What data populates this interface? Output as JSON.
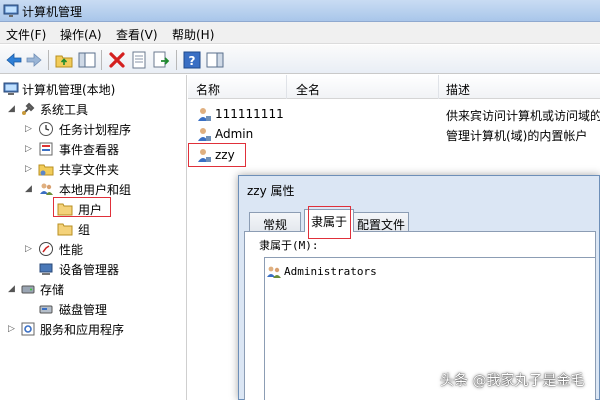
{
  "window": {
    "title": "计算机管理",
    "icon": "computer-management-icon"
  },
  "menu": {
    "items": [
      "文件(F)",
      "操作(A)",
      "查看(V)",
      "帮助(H)"
    ]
  },
  "toolbar": {
    "icons": [
      "back-arrow-icon",
      "forward-arrow-icon",
      "up-folder-icon",
      "show-hide-tree-icon",
      "delete-icon",
      "properties-icon",
      "export-list-icon",
      "help-icon",
      "action-pane-icon"
    ]
  },
  "tree": {
    "root": "计算机管理(本地)",
    "system_tools": "系统工具",
    "task_scheduler": "任务计划程序",
    "event_viewer": "事件查看器",
    "shared_folders": "共享文件夹",
    "local_users_groups": "本地用户和组",
    "users": "用户",
    "groups": "组",
    "performance": "性能",
    "device_manager": "设备管理器",
    "storage": "存储",
    "disk_management": "磁盘管理",
    "services_apps": "服务和应用程序"
  },
  "list": {
    "columns": [
      "名称",
      "全名",
      "描述"
    ],
    "rows": [
      {
        "name": "111111111",
        "fullname": "",
        "description": "供来宾访问计算机或访问域的"
      },
      {
        "name": "Admin",
        "fullname": "",
        "description": "管理计算机(域)的内置帐户"
      },
      {
        "name": "zzy",
        "fullname": "",
        "description": ""
      }
    ]
  },
  "dialog": {
    "title": "zzy 属性",
    "tabs": [
      "常规",
      "隶属于",
      "配置文件"
    ],
    "active_tab": "隶属于",
    "member_of_label": "隶属于(M):",
    "members": [
      "Administrators"
    ]
  },
  "watermark": "头条 @我家丸子是金毛",
  "colors": {
    "highlight_border": "#e0303a",
    "titlebar": "#b8d1ee",
    "selection_folder": "#f4d27a"
  }
}
